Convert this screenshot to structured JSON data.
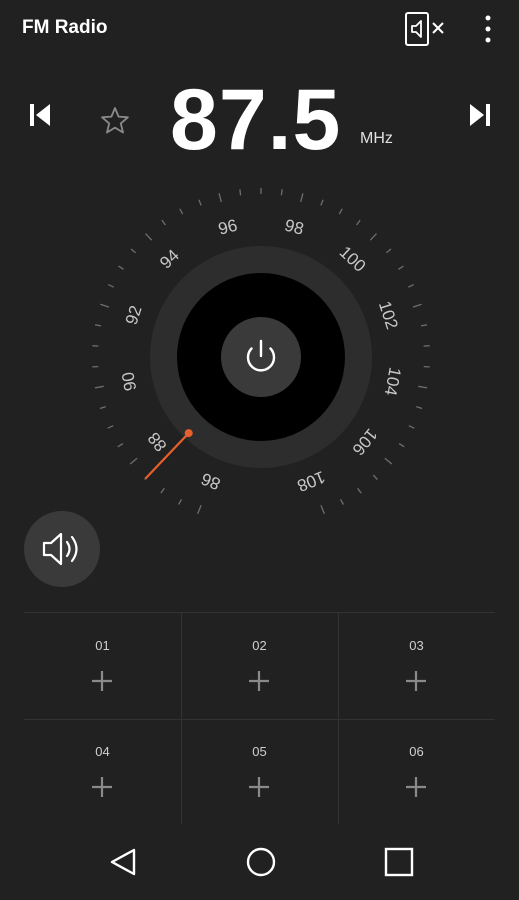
{
  "app": {
    "title": "FM Radio"
  },
  "toolbar": {
    "speaker_toggle_icon": "speaker-off-icon",
    "overflow_icon": "more-vert-icon"
  },
  "tuner": {
    "frequency": "87.5",
    "unit": "MHz",
    "prev_icon": "skip-previous-icon",
    "next_icon": "skip-next-icon",
    "favorite_icon": "star-outline-icon",
    "power_icon": "power-icon",
    "dial_labels": [
      "86",
      "88",
      "90",
      "92",
      "94",
      "96",
      "98",
      "100",
      "102",
      "104",
      "106",
      "108"
    ],
    "current_value": 87.5,
    "range": [
      86,
      108
    ],
    "accent_color": "#e8602c"
  },
  "audio": {
    "sound_icon": "volume-up-icon"
  },
  "presets": [
    {
      "number": "01",
      "icon": "add-icon"
    },
    {
      "number": "02",
      "icon": "add-icon"
    },
    {
      "number": "03",
      "icon": "add-icon"
    },
    {
      "number": "04",
      "icon": "add-icon"
    },
    {
      "number": "05",
      "icon": "add-icon"
    },
    {
      "number": "06",
      "icon": "add-icon"
    }
  ],
  "nav": {
    "back_icon": "back-triangle-icon",
    "home_icon": "home-circle-icon",
    "recents_icon": "recents-square-icon"
  }
}
